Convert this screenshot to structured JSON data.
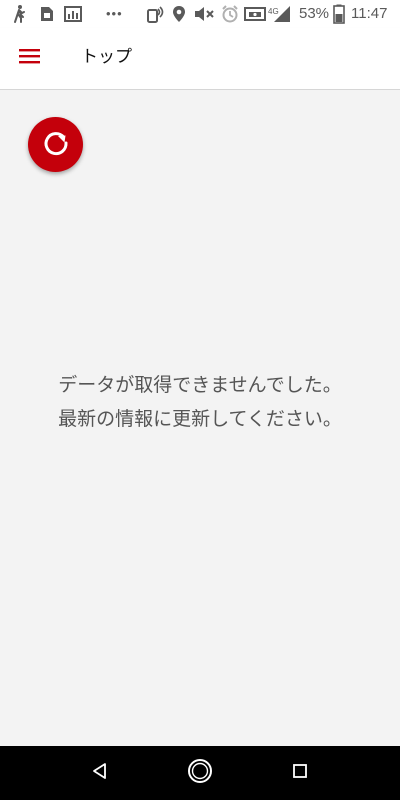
{
  "status_bar": {
    "battery_percent": "53%",
    "time": "11:47",
    "network": "4G",
    "overflow": "•••",
    "icons": [
      "walk-icon",
      "sim-icon",
      "chart-app-icon",
      "nfc-icon",
      "location-icon",
      "mute-icon",
      "alarm-icon",
      "cast-icon",
      "signal-icon",
      "battery-icon"
    ]
  },
  "app_bar": {
    "title": "トップ",
    "menu_icon": "hamburger-menu-icon"
  },
  "content": {
    "refresh_icon": "refresh-icon",
    "message_line1": "データが取得できませんでした。",
    "message_line2": "最新の情報に更新してください。"
  },
  "nav_bar": {
    "back_icon": "back-icon",
    "home_icon": "home-icon",
    "recents_icon": "recents-icon"
  },
  "colors": {
    "accent": "#c4000b",
    "background": "#f3f3f3",
    "text": "#555555"
  }
}
